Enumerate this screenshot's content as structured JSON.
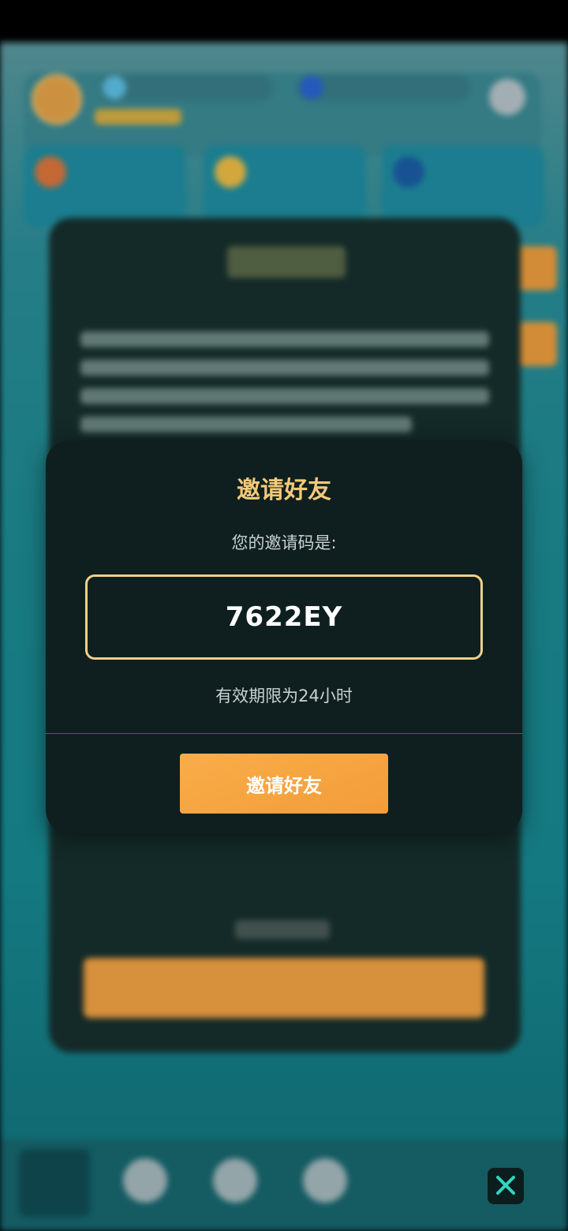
{
  "dialog": {
    "title": "邀请好友",
    "subtitle": "您的邀请码是:",
    "invite_code": "7622EY",
    "validity_note": "有效期限为24小时",
    "invite_button_label": "邀请好友"
  },
  "icons": {
    "close": "close-icon"
  },
  "colors": {
    "title": "#f4c979",
    "code_border": "#f2d187",
    "button": "#f6a540",
    "dialog_bg": "#0f1f1f",
    "close_icon": "#2fd7c0"
  }
}
